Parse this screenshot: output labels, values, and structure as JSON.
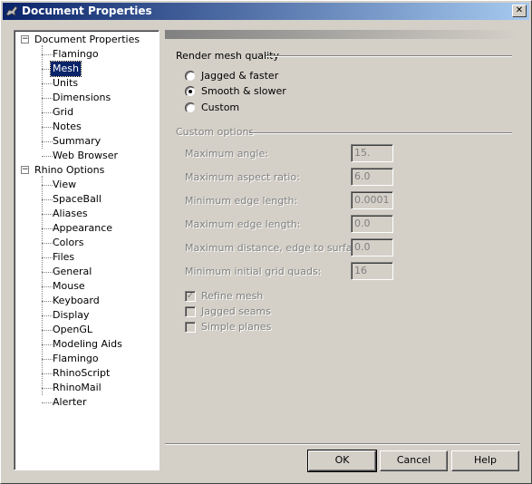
{
  "window": {
    "title": "Document Properties",
    "close_label": "✕"
  },
  "tree": {
    "roots": [
      {
        "label": "Document Properties",
        "expander": "−",
        "children": [
          "Flamingo",
          "Mesh",
          "Units",
          "Dimensions",
          "Grid",
          "Notes",
          "Summary",
          "Web Browser"
        ]
      },
      {
        "label": "Rhino Options",
        "expander": "−",
        "children": [
          "View",
          "SpaceBall",
          "Aliases",
          "Appearance",
          "Colors",
          "Files",
          "General",
          "Mouse",
          "Keyboard",
          "Display",
          "OpenGL",
          "Modeling Aids",
          "Flamingo",
          "RhinoScript",
          "RhinoMail",
          "Alerter"
        ]
      }
    ],
    "selected": "Mesh"
  },
  "render_quality": {
    "label": "Render mesh quality",
    "options": [
      {
        "label": "Jagged & faster",
        "checked": false
      },
      {
        "label": "Smooth & slower",
        "checked": true
      },
      {
        "label": "Custom",
        "checked": false
      }
    ]
  },
  "custom_options": {
    "label": "Custom options",
    "fields": [
      {
        "label": "Maximum angle:",
        "value": "15."
      },
      {
        "label": "Maximum aspect ratio:",
        "value": "6.0"
      },
      {
        "label": "Minimum edge length:",
        "value": "0.0001"
      },
      {
        "label": "Maximum edge length:",
        "value": "0.0"
      },
      {
        "label": "Maximum distance, edge to surface:",
        "value": "0.0"
      },
      {
        "label": "Minimum initial grid quads:",
        "value": "16"
      }
    ],
    "checkboxes": [
      {
        "label": "Refine mesh",
        "checked": true
      },
      {
        "label": "Jagged seams",
        "checked": false
      },
      {
        "label": "Simple planes",
        "checked": false
      }
    ]
  },
  "buttons": {
    "ok": "OK",
    "cancel": "Cancel",
    "help": "Help"
  }
}
